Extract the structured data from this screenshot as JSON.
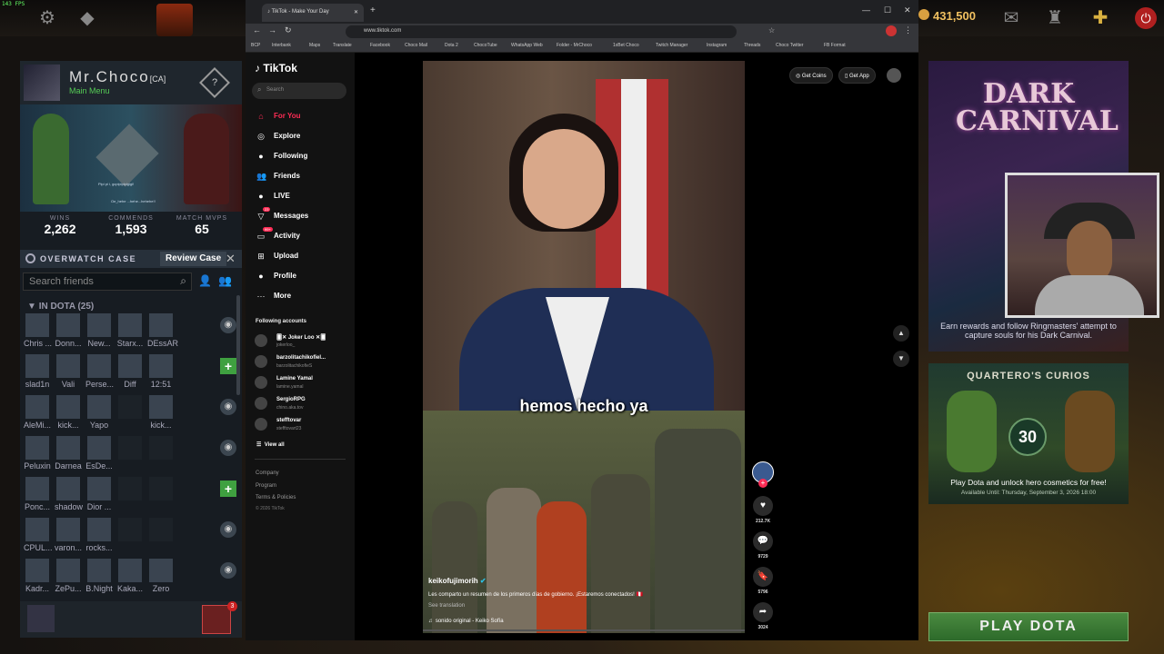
{
  "dota": {
    "fps": "143 FPS",
    "gold": "431,500",
    "profile": {
      "name": "Mr.Choco",
      "tag": "[CA]",
      "status": "Main Menu",
      "rank": "?",
      "quote1": "Pipi pi i, gcpipipipigigi!",
      "quote2": "Oe_hehe ...hehe...hehehe!!",
      "stats": [
        {
          "label": "WINS",
          "value": "2,262"
        },
        {
          "label": "COMMENDS",
          "value": "1,593"
        },
        {
          "label": "MATCH MVPS",
          "value": "65"
        }
      ]
    },
    "overwatch": {
      "label": "OVERWATCH CASE",
      "button": "Review Case"
    },
    "friends": {
      "search_placeholder": "Search friends",
      "group": "IN DOTA (25)",
      "rows": [
        {
          "names": [
            "Chris ...",
            "Donn...",
            "New...",
            "Starx...",
            "DEssAR"
          ],
          "action": "eye"
        },
        {
          "names": [
            "slad1n",
            "Vali",
            "Perse...",
            "Diff",
            "12:51"
          ],
          "action": "plus"
        },
        {
          "names": [
            "AleMi...",
            "kick...",
            "Yapo",
            "",
            "kick..."
          ],
          "action": "eye"
        },
        {
          "names": [
            "Peluxin",
            "Darnea",
            "EsDe...",
            "",
            ""
          ],
          "action": "eye"
        },
        {
          "names": [
            "Ponc...",
            "shadow",
            "Dior ...",
            "",
            ""
          ],
          "action": "plus"
        },
        {
          "names": [
            "CPUL...",
            "varon...",
            "rocks...",
            "",
            ""
          ],
          "action": "eye"
        },
        {
          "names": [
            "Kadr...",
            "ZePu...",
            "B.Night",
            "Kaka...",
            "Zero"
          ],
          "action": "eye"
        }
      ]
    },
    "party_badge": "3",
    "dark_carnival": {
      "title_line1": "DARK",
      "title_line2": "CARNIVAL",
      "desc": "Earn rewards and follow Ringmasters' attempt to capture souls for his Dark Carnival."
    },
    "quartero": {
      "title": "QUARTERO'S CURIOS",
      "badge": "30",
      "desc": "Play Dota and unlock hero cosmetics for free!",
      "avail": "Available Until:  Thursday, September 3, 2026 18:00"
    },
    "play_button": "PLAY DOTA"
  },
  "browser": {
    "tab_title": "TikTok - Make Your Day",
    "url": "www.tiktok.com",
    "bookmarks": [
      "BCP",
      "Interbank",
      "Maps",
      "Translate",
      "Facebook",
      "Choco Mail",
      "Dota 2",
      "ChocoTube",
      "WhatsApp Web",
      "Folder - MrChoco",
      "1xBet Choco",
      "Twitch Manager",
      "Instagram",
      "Threads",
      "Choco Twitter",
      "FB Format"
    ]
  },
  "tiktok": {
    "logo": "TikTok",
    "search_placeholder": "Search",
    "nav": [
      {
        "label": "For You",
        "icon": "home-icon"
      },
      {
        "label": "Explore",
        "icon": "compass-icon"
      },
      {
        "label": "Following",
        "icon": "following-icon"
      },
      {
        "label": "Friends",
        "icon": "friends-icon"
      },
      {
        "label": "LIVE",
        "icon": "live-icon"
      },
      {
        "label": "Messages",
        "icon": "messages-icon",
        "badge": "23"
      },
      {
        "label": "Activity",
        "icon": "activity-icon",
        "badge": "99+"
      },
      {
        "label": "Upload",
        "icon": "upload-icon"
      },
      {
        "label": "Profile",
        "icon": "profile-icon"
      },
      {
        "label": "More",
        "icon": "more-icon"
      }
    ],
    "following_title": "Following accounts",
    "accounts": [
      {
        "name": "🂠✕ Joker Loo ✕🂠",
        "handle": "jokerloo_"
      },
      {
        "name": "barzolitachikofiel...",
        "handle": "barzolitachikofieS"
      },
      {
        "name": "Lamine Yamal",
        "handle": "lamine.yamal"
      },
      {
        "name": "SergioRPG",
        "handle": "chino.aka.tov"
      },
      {
        "name": "stefftovar",
        "handle": "stefftovart23"
      }
    ],
    "view_all": "View all",
    "footer": [
      "Company",
      "Program",
      "Terms & Policies",
      "© 2026 TikTok"
    ],
    "top_buttons": [
      "Get Coins",
      "Get App"
    ],
    "video": {
      "caption": "hemos hecho ya",
      "username": "keikofujimorih",
      "description": "Les comparto un resumen de los primeros días de gobierno. ¡Estaremos conectados! 🇵🇪",
      "see_translation": "See translation",
      "sound": "sonido original - Keiko Sofía",
      "likes": "212.7K",
      "comments": "9729",
      "saves": "5796",
      "shares": "3024"
    }
  }
}
